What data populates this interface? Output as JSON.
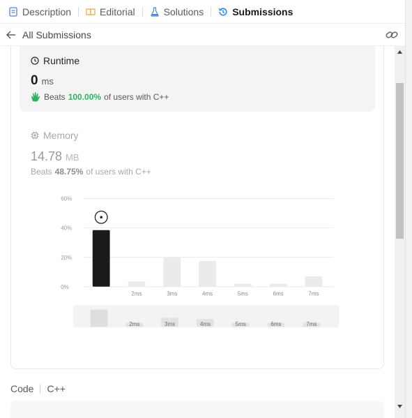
{
  "tabs": [
    {
      "label": "Description",
      "icon": "description-icon"
    },
    {
      "label": "Editorial",
      "icon": "book-icon"
    },
    {
      "label": "Solutions",
      "icon": "flask-icon"
    },
    {
      "label": "Submissions",
      "icon": "history-icon"
    }
  ],
  "subbar": {
    "title": "All Submissions"
  },
  "runtime": {
    "label": "Runtime",
    "value": "0",
    "unit": "ms",
    "beats_prefix": "Beats",
    "beats_pct": "100.00%",
    "beats_suffix": "of users with C++"
  },
  "memory": {
    "label": "Memory",
    "value": "14.78",
    "unit": "MB",
    "beats_prefix": "Beats",
    "beats_pct": "48.75%",
    "beats_suffix": "of users with C++"
  },
  "code": {
    "label": "Code",
    "language": "C++"
  },
  "colors": {
    "accent_green": "#2db55d",
    "active_bar": "#1a1a1a",
    "bar": "#ebebeb",
    "tab_active_icon": "#1e88e5"
  },
  "chart_data": {
    "type": "bar",
    "y_ticks": [
      "60%",
      "40%",
      "20%",
      "0%"
    ],
    "ylim": [
      0,
      60
    ],
    "categories": [
      "",
      "2ms",
      "3ms",
      "4ms",
      "5ms",
      "6ms",
      "7ms"
    ],
    "values": [
      38.5,
      3.5,
      20,
      17.5,
      2,
      2,
      7
    ],
    "highlight_index": 0,
    "overview_labels": [
      "2ms",
      "3ms",
      "4ms",
      "5ms",
      "6ms",
      "7ms"
    ]
  }
}
